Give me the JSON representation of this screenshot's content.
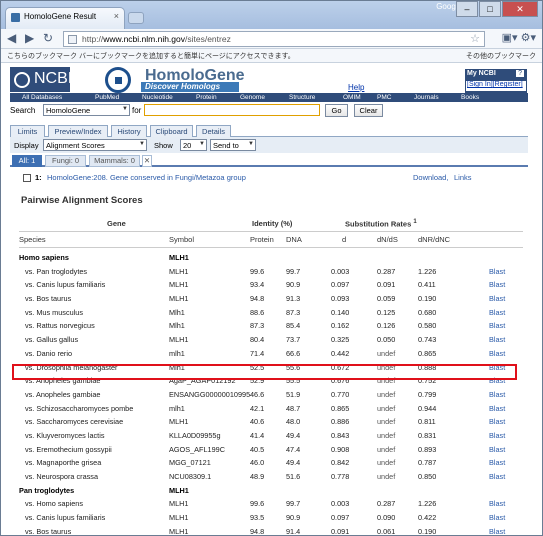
{
  "browser": {
    "tab_title": "HomoloGene Result",
    "google_label": "Google",
    "url_prefix": "http://",
    "url_host": "www.ncbi.nlm.nih.gov",
    "url_path": "/sites/entrez",
    "bookmark_bar_text": "こちらのブックマーク バーにブックマークを追加すると簡単にページにアクセスできます。",
    "other_bookmarks": "その他のブックマーク"
  },
  "header": {
    "ncbi_logo": "NCBI",
    "homologene_name": "HomoloGene",
    "homologene_tagline": "Discover Homologs",
    "help": "Help",
    "my_ncbi_title": "My NCBI",
    "my_ncbi_help": "?",
    "sign_in": "[Sign In]",
    "register": "[Register]"
  },
  "nav": [
    "All Databases",
    "PubMed",
    "Nucleotide",
    "Protein",
    "Genome",
    "Structure",
    "OMIM",
    "PMC",
    "Journals",
    "Books"
  ],
  "search": {
    "label": "Search",
    "database": "HomoloGene",
    "for_label": "for",
    "query": "",
    "go": "Go",
    "clear": "Clear"
  },
  "page_tabs": [
    "Limits",
    "Preview/Index",
    "History",
    "Clipboard",
    "Details"
  ],
  "display": {
    "display_label": "Display",
    "format": "Alignment Scores",
    "show_label": "Show",
    "show_value": "20",
    "send_to": "Send to"
  },
  "sub_tabs": [
    {
      "label": "All: 1",
      "active": true
    },
    {
      "label": "Fungi: 0",
      "active": false
    },
    {
      "label": "Mammals: 0",
      "active": false
    }
  ],
  "result": {
    "number": "1:",
    "link": "HomoloGene:208. Gene conserved in Fungi/Metazoa group",
    "download": "Download,",
    "links": "Links"
  },
  "section_title": "Pairwise Alignment Scores",
  "table_header": {
    "gene": "Gene",
    "identity": "Identity (%)",
    "subst": "Substitution Rates",
    "subst_sup": "1",
    "species": "Species",
    "symbol": "Symbol",
    "protein": "Protein",
    "dna": "DNA",
    "d": "d",
    "dnds": "dN/dS",
    "dnrdnc": "dNR/dNC"
  },
  "rows": [
    {
      "type": "group",
      "species": "Homo sapiens",
      "symbol": "MLH1"
    },
    {
      "species": "vs. Pan troglodytes",
      "symbol": "MLH1",
      "protein": "99.6",
      "dna": "99.7",
      "d": "0.003",
      "dnds": "0.287",
      "dnrdnc": "1.226",
      "blast": "Blast"
    },
    {
      "species": "vs. Canis lupus familiaris",
      "symbol": "MLH1",
      "protein": "93.4",
      "dna": "90.9",
      "d": "0.097",
      "dnds": "0.091",
      "dnrdnc": "0.411",
      "blast": "Blast"
    },
    {
      "species": "vs. Bos taurus",
      "symbol": "MLH1",
      "protein": "94.8",
      "dna": "91.3",
      "d": "0.093",
      "dnds": "0.059",
      "dnrdnc": "0.190",
      "blast": "Blast"
    },
    {
      "species": "vs. Mus musculus",
      "symbol": "Mlh1",
      "protein": "88.6",
      "dna": "87.3",
      "d": "0.140",
      "dnds": "0.125",
      "dnrdnc": "0.680",
      "blast": "Blast",
      "highlight": true
    },
    {
      "species": "vs. Rattus norvegicus",
      "symbol": "Mlh1",
      "protein": "87.3",
      "dna": "85.4",
      "d": "0.162",
      "dnds": "0.126",
      "dnrdnc": "0.580",
      "blast": "Blast"
    },
    {
      "species": "vs. Gallus gallus",
      "symbol": "MLH1",
      "protein": "80.4",
      "dna": "73.7",
      "d": "0.325",
      "dnds": "0.050",
      "dnrdnc": "0.743",
      "blast": "Blast"
    },
    {
      "species": "vs. Danio rerio",
      "symbol": "mlh1",
      "protein": "71.4",
      "dna": "66.6",
      "d": "0.442",
      "dnds": "undef",
      "dnrdnc": "0.865",
      "blast": "Blast"
    },
    {
      "species": "vs. Drosophila melanogaster",
      "symbol": "Mlh1",
      "protein": "52.5",
      "dna": "55.6",
      "d": "0.672",
      "dnds": "undef",
      "dnrdnc": "0.888",
      "blast": "Blast"
    },
    {
      "species": "vs. Anopheles gambiae",
      "symbol": "AgaP_AGAP012192",
      "protein": "52.9",
      "dna": "55.5",
      "d": "0.676",
      "dnds": "undef",
      "dnrdnc": "0.752",
      "blast": "Blast"
    },
    {
      "species": "vs. Anopheles gambiae",
      "symbol": "ENSANGG00000010995",
      "protein": "46.6",
      "dna": "51.9",
      "d": "0.770",
      "dnds": "undef",
      "dnrdnc": "0.799",
      "blast": "Blast"
    },
    {
      "species": "vs. Schizosaccharomyces pombe",
      "symbol": "mlh1",
      "protein": "42.1",
      "dna": "48.7",
      "d": "0.865",
      "dnds": "undef",
      "dnrdnc": "0.944",
      "blast": "Blast"
    },
    {
      "species": "vs. Saccharomyces cerevisiae",
      "symbol": "MLH1",
      "protein": "40.6",
      "dna": "48.0",
      "d": "0.886",
      "dnds": "undef",
      "dnrdnc": "0.811",
      "blast": "Blast"
    },
    {
      "species": "vs. Kluyveromyces lactis",
      "symbol": "KLLA0D09955g",
      "protein": "41.4",
      "dna": "49.4",
      "d": "0.843",
      "dnds": "undef",
      "dnrdnc": "0.831",
      "blast": "Blast"
    },
    {
      "species": "vs. Eremothecium gossypii",
      "symbol": "AGOS_AFL199C",
      "protein": "40.5",
      "dna": "47.4",
      "d": "0.908",
      "dnds": "undef",
      "dnrdnc": "0.893",
      "blast": "Blast"
    },
    {
      "species": "vs. Magnaporthe grisea",
      "symbol": "MGG_07121",
      "protein": "46.0",
      "dna": "49.4",
      "d": "0.842",
      "dnds": "undef",
      "dnrdnc": "0.787",
      "blast": "Blast"
    },
    {
      "species": "vs. Neurospora crassa",
      "symbol": "NCU08309.1",
      "protein": "48.9",
      "dna": "51.6",
      "d": "0.778",
      "dnds": "undef",
      "dnrdnc": "0.850",
      "blast": "Blast"
    },
    {
      "type": "group",
      "species": "Pan troglodytes",
      "symbol": "MLH1"
    },
    {
      "species": "vs. Homo sapiens",
      "symbol": "MLH1",
      "protein": "99.6",
      "dna": "99.7",
      "d": "0.003",
      "dnds": "0.287",
      "dnrdnc": "1.226",
      "blast": "Blast"
    },
    {
      "species": "vs. Canis lupus familiaris",
      "symbol": "MLH1",
      "protein": "93.5",
      "dna": "90.9",
      "d": "0.097",
      "dnds": "0.090",
      "dnrdnc": "0.422",
      "blast": "Blast"
    },
    {
      "species": "vs. Bos taurus",
      "symbol": "MLH1",
      "protein": "94.8",
      "dna": "91.4",
      "d": "0.091",
      "dnds": "0.061",
      "dnrdnc": "0.190",
      "blast": "Blast"
    }
  ],
  "colors": {
    "accent": "#2f4c7a",
    "link": "#2a5aa8",
    "highlight": "#e0101a"
  }
}
